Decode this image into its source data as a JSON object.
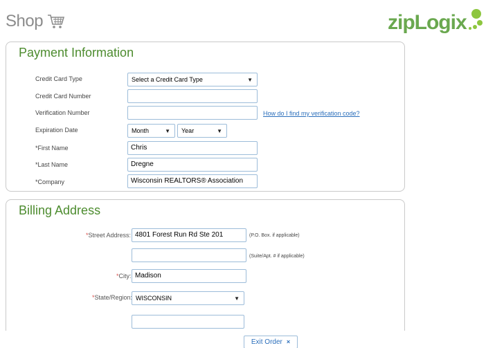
{
  "header": {
    "shop_label": "Shop",
    "logo_text": "zipLogix"
  },
  "colors": {
    "brand_green": "#6aa84f",
    "link_blue": "#2a6ebb",
    "field_border": "#9cbcd9"
  },
  "payment": {
    "title": "Payment Information",
    "card_type_label": "Credit Card Type",
    "card_type_value": "Select a Credit Card Type",
    "card_number_label": "Credit Card Number",
    "card_number_value": "",
    "verification_label": "Verification Number",
    "verification_value": "",
    "verification_help": "How do I find my verification code?",
    "expiration_label": "Expiration Date",
    "month_value": "Month",
    "year_value": "Year",
    "first_name_label": "*First Name",
    "first_name_value": "Chris",
    "last_name_label": "*Last Name",
    "last_name_value": "Dregne",
    "company_label": "*Company",
    "company_value": "Wisconsin REALTORS® Association"
  },
  "billing": {
    "title": "Billing Address",
    "street_label": "Street Address:",
    "street_value": "4801 Forest Run Rd Ste 201",
    "street_hint": "(P.O. Box.  if applicable)",
    "suite_value": "",
    "suite_hint": "(Suite/Apt. # if applicable)",
    "city_label": "City:",
    "city_value": "Madison",
    "state_label": "State/Region:",
    "state_value": "WISCONSIN"
  },
  "footer": {
    "exit_label": "Exit Order",
    "exit_close": "×"
  }
}
